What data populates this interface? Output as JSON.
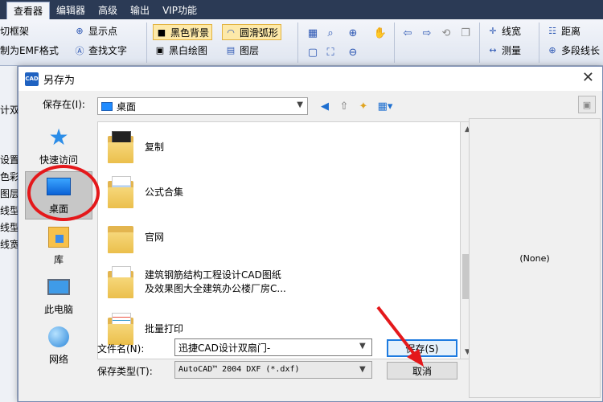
{
  "app": {
    "menu": [
      "查看器",
      "编辑器",
      "高级",
      "输出",
      "VIP功能"
    ],
    "active_menu": "查看器",
    "ribbon": {
      "col1": [
        "切框架",
        "制为EMF格式",
        "制为"
      ],
      "col2": [
        "显示点",
        "查找文字"
      ],
      "col3": [
        "黑色背景",
        "黑白绘图"
      ],
      "col4": [
        "圆滑弧形",
        "图层"
      ],
      "col5": [
        "线宽",
        "测量"
      ],
      "col6": [
        "距离",
        "多段线长"
      ]
    },
    "left_strip": [
      "计双",
      "设置",
      "色彩",
      "图层",
      "线型",
      "线型",
      "线宽"
    ]
  },
  "dialog": {
    "title": "另存为",
    "logo_text": "CAD",
    "save_in_label": "保存在(I):",
    "save_in_value": "桌面",
    "places": [
      {
        "label": "快速访问",
        "icon": "star-icon"
      },
      {
        "label": "桌面",
        "icon": "desktop-icon",
        "selected": true
      },
      {
        "label": "库",
        "icon": "library-icon"
      },
      {
        "label": "此电脑",
        "icon": "computer-icon"
      },
      {
        "label": "网络",
        "icon": "network-icon"
      }
    ],
    "files": [
      {
        "line1": "复制",
        "line2": ""
      },
      {
        "line1": "公式合集",
        "line2": ""
      },
      {
        "line1": "官网",
        "line2": ""
      },
      {
        "line1": "建筑钢筋结构工程设计CAD图纸",
        "line2": "及效果图大全建筑办公楼厂房C..."
      },
      {
        "line1": "批量打印",
        "line2": ""
      }
    ],
    "preview_text": "(None)",
    "filename_label": "文件名(N):",
    "filename_value": "迅捷CAD设计双扇门-",
    "filetype_label": "保存类型(T):",
    "filetype_value": "AutoCAD™ 2004 DXF (*.dxf)",
    "save_button": "保存(S)",
    "cancel_button": "取消"
  }
}
